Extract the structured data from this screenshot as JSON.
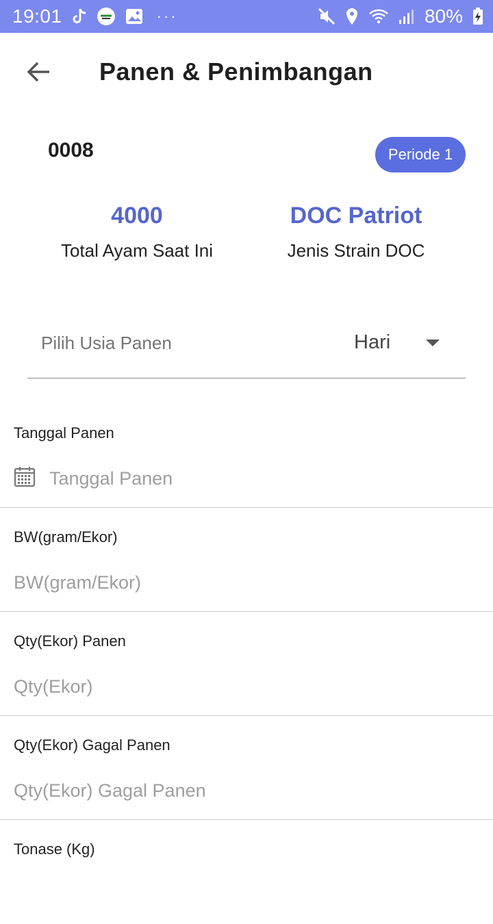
{
  "status_bar": {
    "time": "19:01",
    "left_icons": [
      "tiktok-icon",
      "app-logo-icon",
      "image-icon"
    ],
    "more": "···",
    "right_icons": [
      "mute-icon",
      "location-icon",
      "wifi-icon",
      "signal-icon"
    ],
    "battery": "80%"
  },
  "header": {
    "title": "Panen & Penimbangan",
    "back_icon": "arrow-left-icon"
  },
  "summary": {
    "code": "0008",
    "period": "Periode 1",
    "total_value": "4000",
    "total_label": "Total Ayam Saat Ini",
    "strain_value": "DOC Patriot",
    "strain_label": "Jenis Strain DOC"
  },
  "age_select": {
    "placeholder": "Pilih Usia Panen",
    "value": "Hari"
  },
  "fields": [
    {
      "label": "Tanggal Panen",
      "placeholder": "Tanggal Panen",
      "icon": "calendar-icon"
    },
    {
      "label": "BW(gram/Ekor)",
      "placeholder": "BW(gram/Ekor)"
    },
    {
      "label": "Qty(Ekor) Panen",
      "placeholder": "Qty(Ekor)"
    },
    {
      "label": "Qty(Ekor) Gagal Panen",
      "placeholder": "Qty(Ekor) Gagal Panen"
    },
    {
      "label": "Tonase (Kg)",
      "placeholder": ""
    }
  ],
  "colors": {
    "status_bar": "#7b88ee",
    "accent": "#5b6ee0",
    "stat_text": "#5566cc"
  }
}
